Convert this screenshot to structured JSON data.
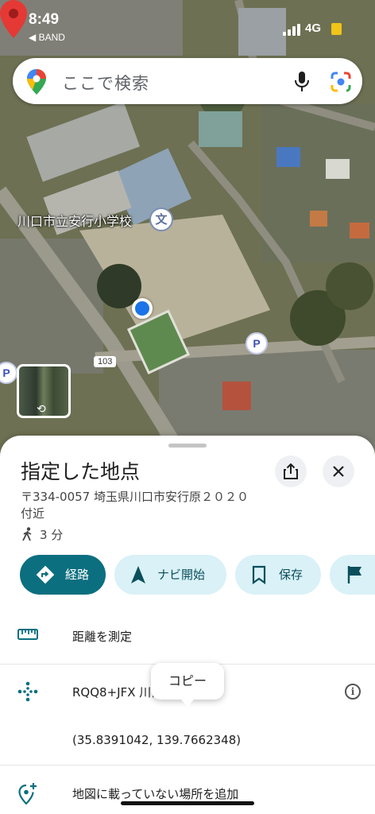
{
  "status_bar": {
    "time": "8:49",
    "back_app": "◀ BAND",
    "network": "4G"
  },
  "search": {
    "placeholder": "ここで検索"
  },
  "map": {
    "school_label": "川口市立安行小学校",
    "school_icon_glyph": "文",
    "road_number": "103",
    "parking_glyph": "P"
  },
  "place": {
    "title": "指定した地点",
    "address": "〒334-0057 埼玉県川口市安行原２０２０付近",
    "walk_time": "3 分"
  },
  "actions": [
    {
      "label": "経路",
      "icon": "directions-icon"
    },
    {
      "label": "ナビ開始",
      "icon": "navigation-icon"
    },
    {
      "label": "保存",
      "icon": "bookmark-icon"
    },
    {
      "label": "",
      "icon": "flag-icon"
    }
  ],
  "rows": {
    "measure": "距離を測定",
    "plus_code": "RQQ8+JFX 川口市, 埼玉県",
    "coordinates": "(35.8391042, 139.7662348)",
    "add_place": "地図に載っていない場所を追加"
  },
  "tooltip": "コピー",
  "colors": {
    "primary_chip": "#0b6f80",
    "secondary_chip": "#d9f1f7",
    "accent_teal": "#0b6f80",
    "pin_red": "#e53935",
    "location_blue": "#1a73e8"
  }
}
